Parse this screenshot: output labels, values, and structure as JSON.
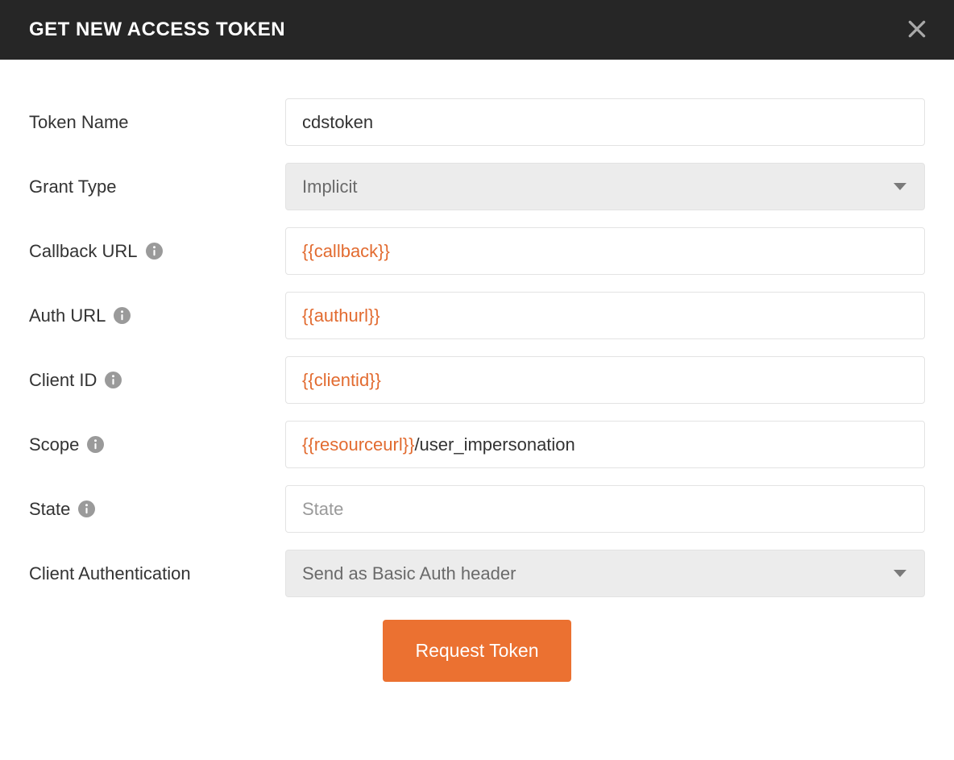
{
  "header": {
    "title": "GET NEW ACCESS TOKEN"
  },
  "colors": {
    "accent": "#eb7131",
    "variable": "#e26b30"
  },
  "form": {
    "token_name": {
      "label": "Token Name",
      "value": "cdstoken"
    },
    "grant_type": {
      "label": "Grant Type",
      "value": "Implicit"
    },
    "callback_url": {
      "label": "Callback URL",
      "variable": "{{callback}}",
      "suffix": ""
    },
    "auth_url": {
      "label": "Auth URL",
      "variable": "{{authurl}}",
      "suffix": ""
    },
    "client_id": {
      "label": "Client ID",
      "variable": "{{clientid}}",
      "suffix": ""
    },
    "scope": {
      "label": "Scope",
      "variable": "{{resourceurl}}",
      "suffix": "/user_impersonation"
    },
    "state": {
      "label": "State",
      "value": "",
      "placeholder": "State"
    },
    "client_auth": {
      "label": "Client Authentication",
      "value": "Send as Basic Auth header"
    }
  },
  "buttons": {
    "request_token": "Request Token"
  }
}
